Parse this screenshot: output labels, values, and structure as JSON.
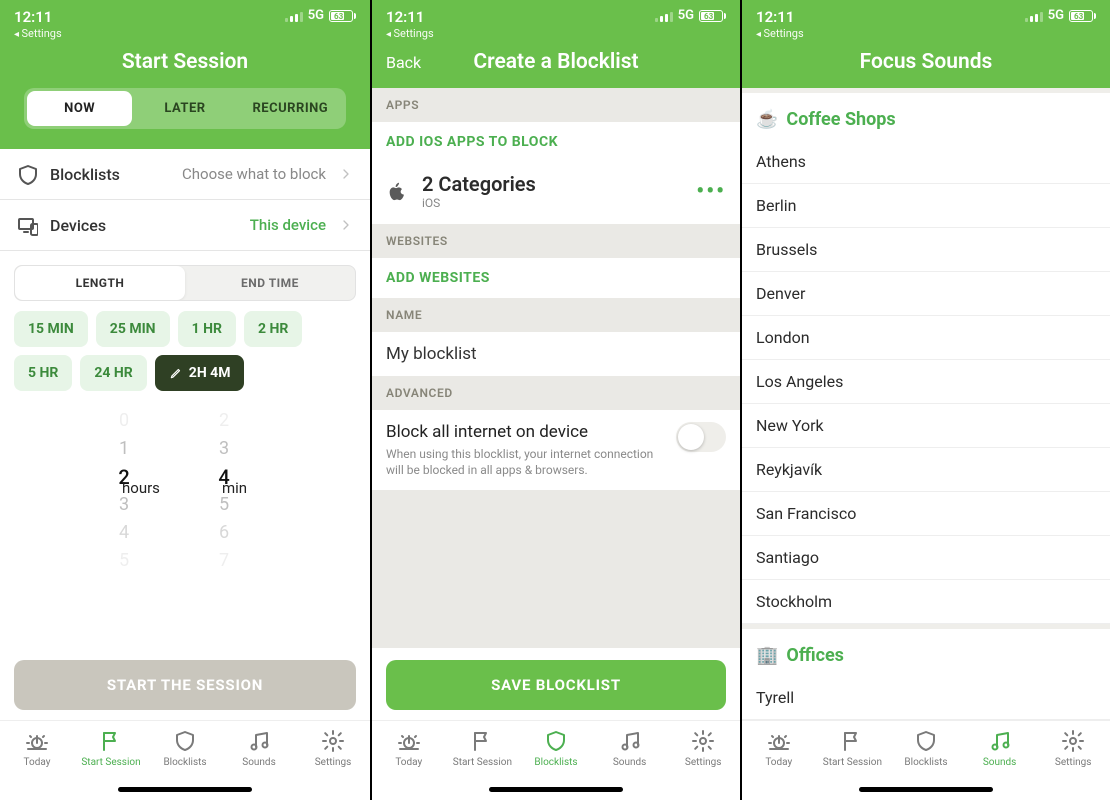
{
  "status": {
    "time": "12:11",
    "breadcrumb": "Settings",
    "network": "5G",
    "battery_pct": "63"
  },
  "tabs": [
    {
      "id": "today",
      "label": "Today"
    },
    {
      "id": "start",
      "label": "Start Session"
    },
    {
      "id": "blocklists",
      "label": "Blocklists"
    },
    {
      "id": "sounds",
      "label": "Sounds"
    },
    {
      "id": "settings",
      "label": "Settings"
    }
  ],
  "screen1": {
    "title": "Start Session",
    "tabs3": [
      "NOW",
      "LATER",
      "RECURRING"
    ],
    "blocklists_label": "Blocklists",
    "blocklists_value": "Choose what to block",
    "devices_label": "Devices",
    "devices_value": "This device",
    "tabs2": [
      "LENGTH",
      "END TIME"
    ],
    "chips": [
      "15 MIN",
      "25 MIN",
      "1 HR",
      "2 HR",
      "5 HR",
      "24 HR"
    ],
    "chip_selected": "2H 4M",
    "picker": {
      "hours_visible": [
        "0",
        "1",
        "2",
        "3",
        "4",
        "5"
      ],
      "hours_selected_index": 2,
      "hours_label": "hours",
      "mins_visible": [
        "2",
        "3",
        "4",
        "5",
        "6",
        "7"
      ],
      "mins_selected_index": 2,
      "mins_label": "min"
    },
    "cta": "START THE SESSION"
  },
  "screen2": {
    "back": "Back",
    "title": "Create a Blocklist",
    "sections": {
      "apps": "APPS",
      "add_apps": "ADD IOS APPS TO BLOCK",
      "cat_title": "2 Categories",
      "cat_sub": "iOS",
      "websites": "WEBSITES",
      "add_sites": "ADD WEBSITES",
      "name": "NAME",
      "name_value": "My blocklist",
      "advanced": "ADVANCED",
      "adv_title": "Block all internet on device",
      "adv_sub": "When using this blocklist, your internet connection will be blocked in all apps & browsers."
    },
    "cta": "SAVE BLOCKLIST"
  },
  "screen3": {
    "title": "Focus Sounds",
    "cat1": {
      "emoji": "☕️",
      "name": "Coffee Shops"
    },
    "sounds": [
      "Athens",
      "Berlin",
      "Brussels",
      "Denver",
      "London",
      "Los Angeles",
      "New York",
      "Reykjavík",
      "San Francisco",
      "Santiago",
      "Stockholm"
    ],
    "cat2": {
      "emoji": "🏢",
      "name": "Offices"
    },
    "sounds2": [
      "Tyrell"
    ]
  }
}
